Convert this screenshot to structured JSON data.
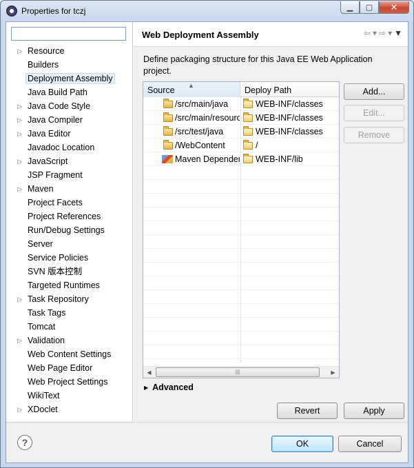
{
  "window": {
    "title": "Properties for tczj",
    "controls": {
      "minimize": "▁",
      "maximize": "▢",
      "close": "✕"
    }
  },
  "filter": {
    "value": "",
    "placeholder": ""
  },
  "tree": [
    {
      "label": "Resource",
      "expandable": true
    },
    {
      "label": "Builders",
      "expandable": false
    },
    {
      "label": "Deployment Assembly",
      "expandable": false,
      "selected": true
    },
    {
      "label": "Java Build Path",
      "expandable": false
    },
    {
      "label": "Java Code Style",
      "expandable": true
    },
    {
      "label": "Java Compiler",
      "expandable": true
    },
    {
      "label": "Java Editor",
      "expandable": true
    },
    {
      "label": "Javadoc Location",
      "expandable": false
    },
    {
      "label": "JavaScript",
      "expandable": true
    },
    {
      "label": "JSP Fragment",
      "expandable": false
    },
    {
      "label": "Maven",
      "expandable": true
    },
    {
      "label": "Project Facets",
      "expandable": false
    },
    {
      "label": "Project References",
      "expandable": false
    },
    {
      "label": "Run/Debug Settings",
      "expandable": false
    },
    {
      "label": "Server",
      "expandable": false
    },
    {
      "label": "Service Policies",
      "expandable": false
    },
    {
      "label": "SVN 版本控制",
      "expandable": false
    },
    {
      "label": "Targeted Runtimes",
      "expandable": false
    },
    {
      "label": "Task Repository",
      "expandable": true
    },
    {
      "label": "Task Tags",
      "expandable": false
    },
    {
      "label": "Tomcat",
      "expandable": false
    },
    {
      "label": "Validation",
      "expandable": true
    },
    {
      "label": "Web Content Settings",
      "expandable": false
    },
    {
      "label": "Web Page Editor",
      "expandable": false
    },
    {
      "label": "Web Project Settings",
      "expandable": false
    },
    {
      "label": "WikiText",
      "expandable": false
    },
    {
      "label": "XDoclet",
      "expandable": true
    }
  ],
  "page": {
    "title": "Web Deployment Assembly",
    "nav": {
      "back": "⇦",
      "forward": "⇨",
      "dropdown": "▾",
      "menu": "▼"
    },
    "description": "Define packaging structure for this Java EE Web Application project.",
    "table": {
      "columns": {
        "source": "Source",
        "deploy": "Deploy Path"
      },
      "rows": [
        {
          "source": "/src/main/java",
          "deploy": "WEB-INF/classes",
          "source_icon": "folder-icon"
        },
        {
          "source": "/src/main/resources",
          "deploy": "WEB-INF/classes",
          "source_icon": "folder-icon"
        },
        {
          "source": "/src/test/java",
          "deploy": "WEB-INF/classes",
          "source_icon": "folder-icon"
        },
        {
          "source": "/WebContent",
          "deploy": "/",
          "source_icon": "folder-icon"
        },
        {
          "source": "Maven Dependencies",
          "deploy": "WEB-INF/lib",
          "source_icon": "maven-library-icon"
        }
      ],
      "empty_rows": 14
    },
    "buttons": {
      "add": "Add...",
      "edit": "Edit...",
      "remove": "Remove"
    },
    "advanced": "Advanced",
    "revert": "Revert",
    "apply": "Apply"
  },
  "footer": {
    "help": "?",
    "ok": "OK",
    "cancel": "Cancel"
  }
}
